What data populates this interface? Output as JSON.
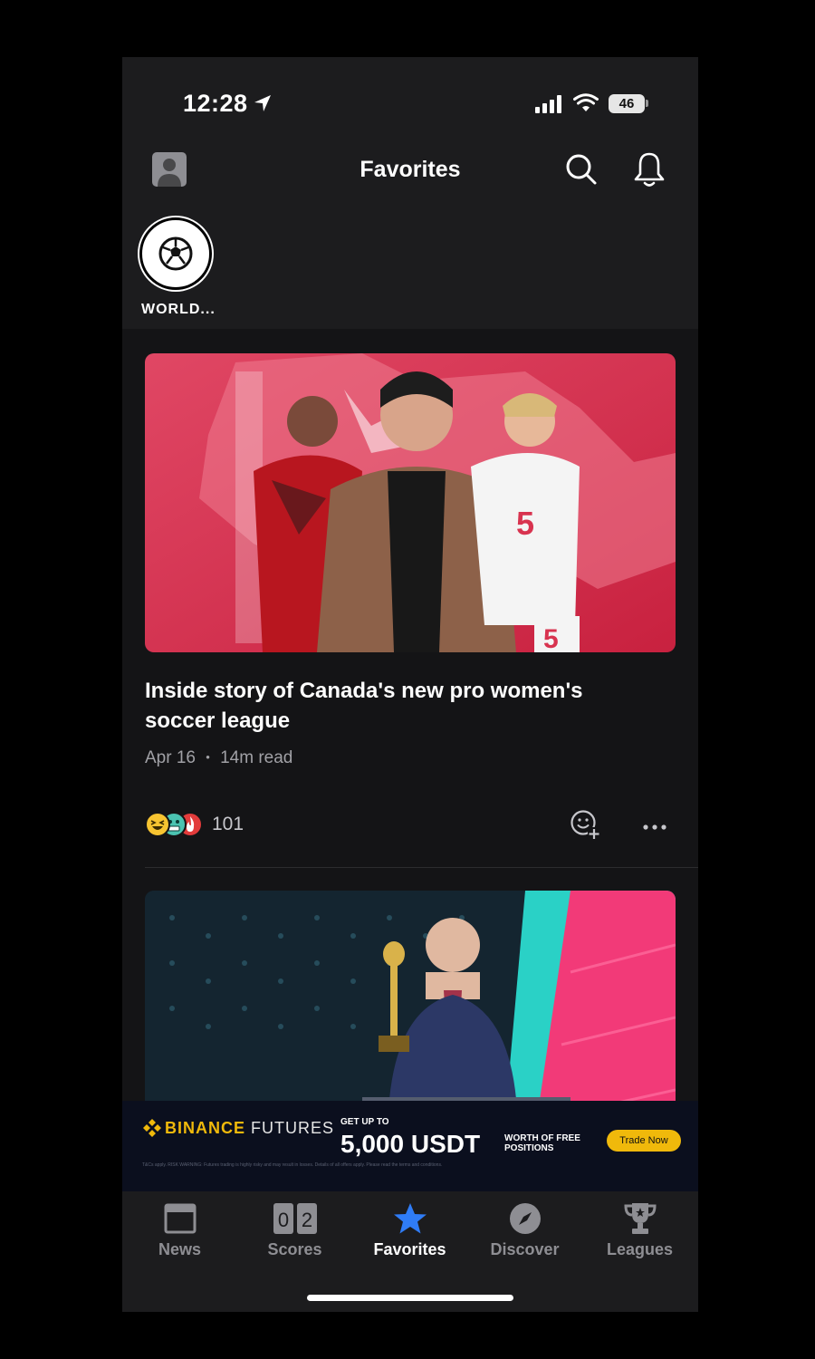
{
  "status_bar": {
    "time": "12:28",
    "battery": "46"
  },
  "header": {
    "title": "Favorites"
  },
  "favorites": [
    {
      "label": "WORLD..."
    }
  ],
  "articles": [
    {
      "headline": "Inside story of Canada's new pro women's soccer league",
      "date": "Apr 16",
      "separator": "•",
      "read_time": "14m read",
      "reaction_count": "101",
      "reactions": [
        "laughing-emoji",
        "cold-face-emoji",
        "fire-emoji"
      ]
    }
  ],
  "ad": {
    "brand": "BINANCE",
    "product": "FUTURES",
    "small": "GET UP TO",
    "big": "5,000 USDT",
    "worth": "WORTH OF FREE POSITIONS",
    "cta": "Trade Now",
    "fine_print": "T&Cs apply. RISK WARNING: Futures trading is highly risky and may result in losses. Details of all offers apply. Please read the terms and conditions."
  },
  "tabs": [
    {
      "label": "News",
      "icon": "news-icon",
      "active": false
    },
    {
      "label": "Scores",
      "icon": "scores-icon",
      "active": false
    },
    {
      "label": "Favorites",
      "icon": "star-icon",
      "active": true
    },
    {
      "label": "Discover",
      "icon": "compass-icon",
      "active": false
    },
    {
      "label": "Leagues",
      "icon": "trophy-icon",
      "active": false
    }
  ],
  "colors": {
    "accent": "#2f7cf6",
    "background": "#141416",
    "bar": "#1c1c1e",
    "hero_red": "#d8334f"
  }
}
